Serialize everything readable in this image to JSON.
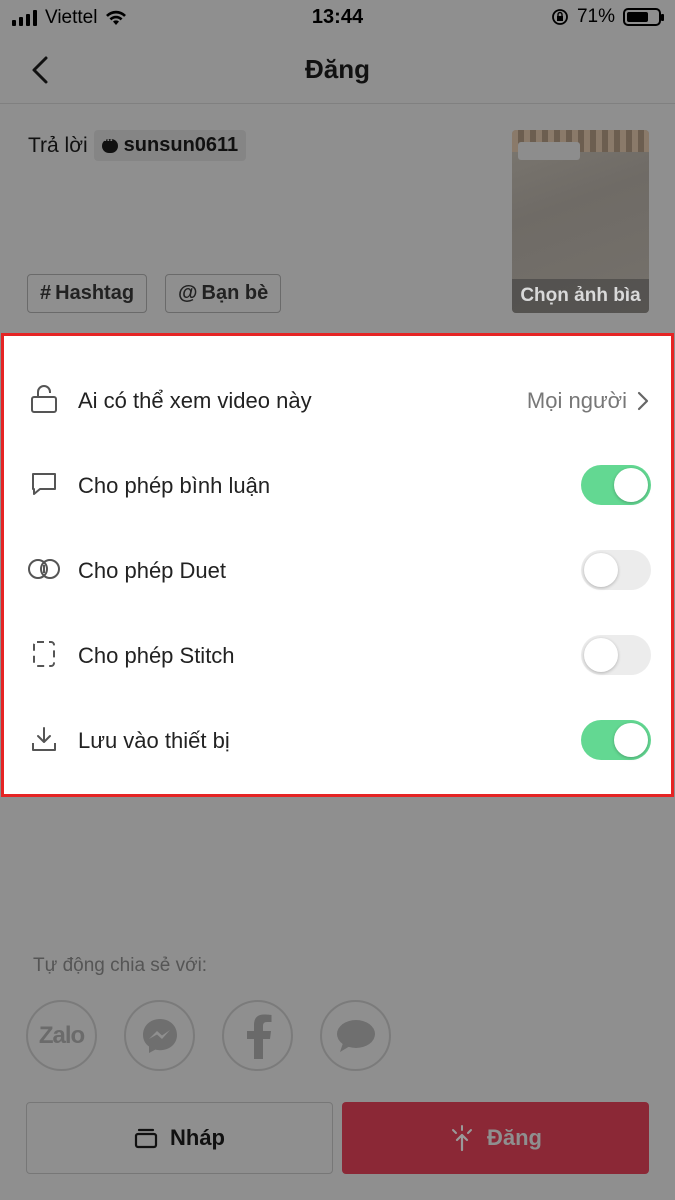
{
  "status_bar": {
    "carrier": "Viettel",
    "time": "13:44",
    "battery": "71%",
    "battery_level": 0.71
  },
  "header": {
    "title": "Đăng",
    "back_icon": "chevron-left-icon"
  },
  "caption": {
    "reply_prefix": "Trả lời",
    "reply_user": "sunsun0611"
  },
  "tags": {
    "hashtag": "Hashtag",
    "friends": "Bạn bè"
  },
  "cover": {
    "label": "Chọn ảnh bìa"
  },
  "settings": {
    "privacy": {
      "label": "Ai có thể xem video này",
      "value": "Mọi người",
      "icon": "unlock-icon"
    },
    "comments": {
      "label": "Cho phép bình luận",
      "enabled": true,
      "icon": "comment-icon"
    },
    "duet": {
      "label": "Cho phép Duet",
      "enabled": false,
      "icon": "duet-icon"
    },
    "stitch": {
      "label": "Cho phép Stitch",
      "enabled": false,
      "icon": "stitch-icon"
    },
    "save": {
      "label": "Lưu vào thiết bị",
      "enabled": true,
      "icon": "download-icon"
    }
  },
  "share": {
    "label": "Tự động chia sẻ với:",
    "targets": [
      "Zalo",
      "Messenger",
      "Facebook",
      "Messages"
    ]
  },
  "buttons": {
    "draft": "Nháp",
    "post": "Đăng"
  },
  "colors": {
    "toggle_on": "#63d892",
    "post_button": "#8b2836",
    "highlight_border": "#e52424"
  }
}
